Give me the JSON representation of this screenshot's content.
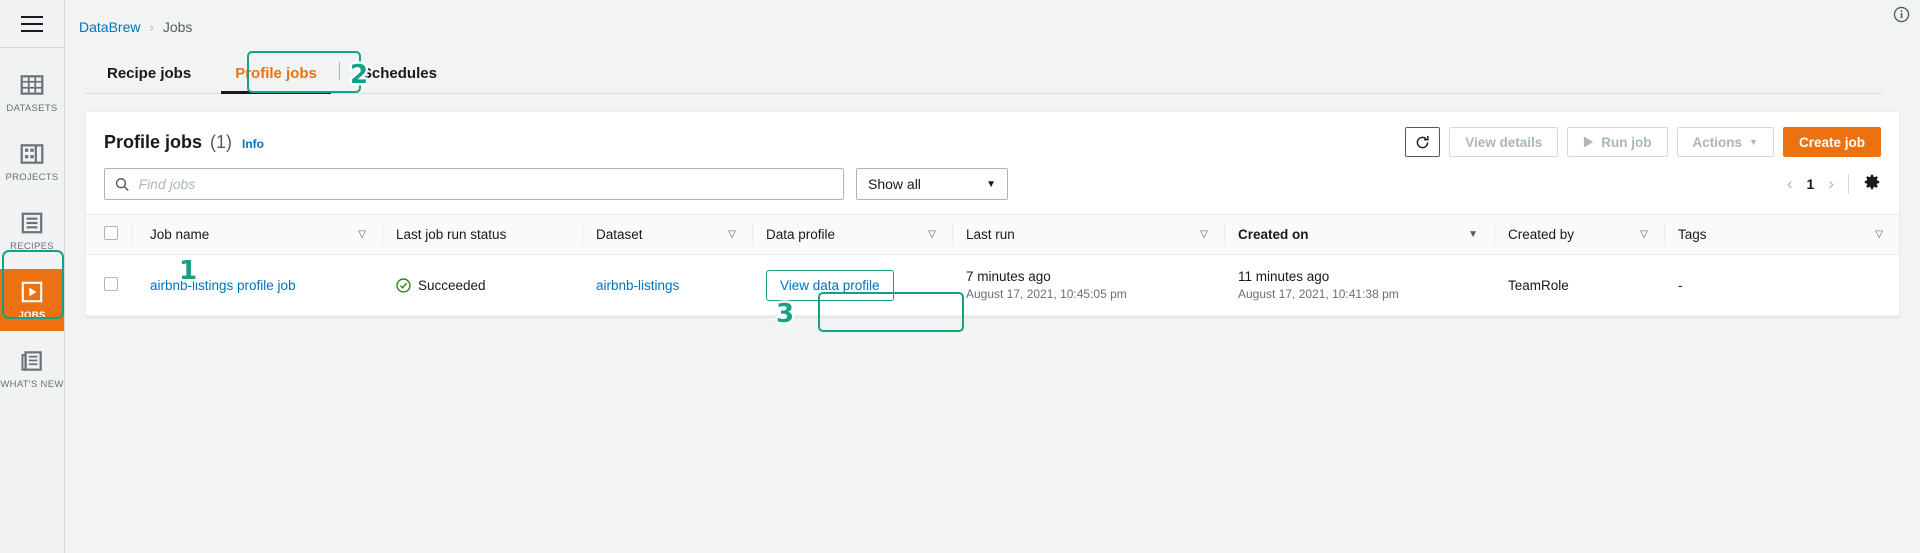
{
  "sidebar": {
    "menu_toggle": "menu-icon",
    "items": [
      {
        "label": "DATASETS",
        "icon": "datasets-grid-icon",
        "active": false
      },
      {
        "label": "PROJECTS",
        "icon": "projects-icon",
        "active": false
      },
      {
        "label": "RECIPES",
        "icon": "recipes-list-icon",
        "active": false
      },
      {
        "label": "JOBS",
        "icon": "jobs-play-icon",
        "active": true
      },
      {
        "label": "WHAT'S NEW",
        "icon": "whats-new-icon",
        "active": false
      }
    ]
  },
  "breadcrumb": {
    "root": "DataBrew",
    "separator": "›",
    "current": "Jobs"
  },
  "tabs": [
    {
      "label": "Recipe jobs",
      "selected": false
    },
    {
      "label": "Profile jobs",
      "selected": true
    },
    {
      "label": "Schedules",
      "selected": false
    }
  ],
  "panel": {
    "title": "Profile jobs",
    "count": "(1)",
    "info_label": "Info",
    "actions": {
      "refresh_icon": "refresh-icon",
      "view_details": "View details",
      "run_job": "Run job",
      "actions_menu": "Actions",
      "create_job": "Create job"
    },
    "search": {
      "placeholder": "Find jobs",
      "value": "",
      "icon": "search-icon"
    },
    "filter": {
      "selected": "Show all",
      "options": [
        "Show all"
      ]
    },
    "pagination": {
      "prev": "‹",
      "page": "1",
      "next": "›",
      "settings_icon": "gear-icon"
    }
  },
  "table": {
    "columns": [
      {
        "label": "Job name",
        "sortable": true,
        "sorted": false
      },
      {
        "label": "Last job run status",
        "sortable": false,
        "sorted": false
      },
      {
        "label": "Dataset",
        "sortable": true,
        "sorted": false
      },
      {
        "label": "Data profile",
        "sortable": true,
        "sorted": false
      },
      {
        "label": "Last run",
        "sortable": true,
        "sorted": false
      },
      {
        "label": "Created on",
        "sortable": true,
        "sorted": true
      },
      {
        "label": "Created by",
        "sortable": true,
        "sorted": false
      },
      {
        "label": "Tags",
        "sortable": true,
        "sorted": false
      }
    ],
    "rows": [
      {
        "job_name": "airbnb-listings profile job",
        "status": "Succeeded",
        "status_icon": "success-check-icon",
        "dataset": "airbnb-listings",
        "data_profile_button": "View data profile",
        "last_run_relative": "7 minutes ago",
        "last_run_absolute": "August 17, 2021, 10:45:05 pm",
        "created_relative": "11 minutes ago",
        "created_absolute": "August 17, 2021, 10:41:38 pm",
        "created_by": "TeamRole",
        "tags": "-"
      }
    ]
  },
  "annotations": [
    {
      "number": "1"
    },
    {
      "number": "2"
    },
    {
      "number": "3"
    }
  ],
  "top_right": {
    "info_icon": "info-circle-icon"
  },
  "colors": {
    "accent_orange": "#ec7211",
    "link_blue": "#0073bb",
    "annotation_green": "#16a085",
    "success_green": "#1d8102",
    "sidebar_bg": "#f1f3f3",
    "page_bg": "#f2f3f3"
  }
}
